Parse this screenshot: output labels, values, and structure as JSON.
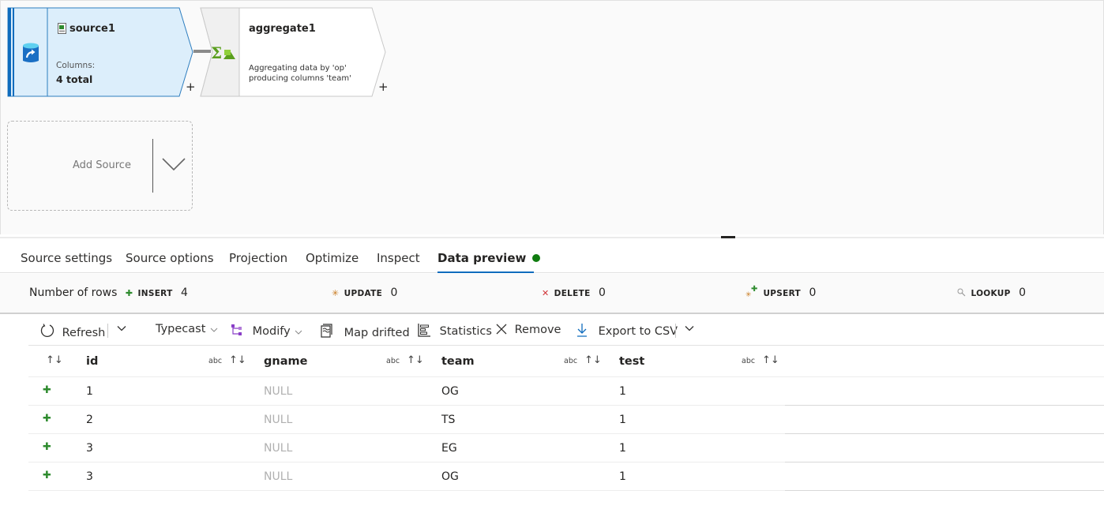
{
  "canvas": {
    "source_node": {
      "title": "source1",
      "columns_label": "Columns:",
      "columns_value": "4 total",
      "icon": "database-source-icon",
      "file_icon": "csv-file-icon",
      "add_label": "+"
    },
    "aggregate_node": {
      "title": "aggregate1",
      "description_line1": "Aggregating data by 'op'",
      "description_line2": "producing columns 'team'",
      "icon": "aggregate-sigma-icon",
      "add_label": "+"
    },
    "add_source": {
      "label": "Add Source",
      "icon": "chevron-down-icon"
    }
  },
  "tabs": [
    {
      "label": "Source settings",
      "active": false
    },
    {
      "label": "Source options",
      "active": false
    },
    {
      "label": "Projection",
      "active": false
    },
    {
      "label": "Optimize",
      "active": false
    },
    {
      "label": "Inspect",
      "active": false
    },
    {
      "label": "Data preview",
      "active": true,
      "status_color": "#107c10"
    }
  ],
  "row_counts": {
    "label": "Number of rows",
    "insert": {
      "keyword": "INSERT",
      "value": "4",
      "color": "#2e8b2e"
    },
    "update": {
      "keyword": "UPDATE",
      "value": "0",
      "color": "#c87a1e"
    },
    "delete": {
      "keyword": "DELETE",
      "value": "0",
      "color": "#d13438"
    },
    "upsert": {
      "keyword": "UPSERT",
      "value": "0",
      "color": "#2e8b2e"
    },
    "lookup": {
      "keyword": "LOOKUP",
      "value": "0",
      "color": "#888888"
    }
  },
  "toolbar": {
    "refresh": "Refresh",
    "typecast": "Typecast",
    "modify": "Modify",
    "map_drifted": "Map drifted",
    "statistics": "Statistics",
    "remove": "Remove",
    "export_csv": "Export to CSV"
  },
  "table": {
    "type_label": "abc",
    "columns": [
      "id",
      "gname",
      "team",
      "test"
    ],
    "rows": [
      {
        "op": "+",
        "id": "1",
        "gname": "NULL",
        "team": "OG",
        "test": "1"
      },
      {
        "op": "+",
        "id": "2",
        "gname": "NULL",
        "team": "TS",
        "test": "1"
      },
      {
        "op": "+",
        "id": "3",
        "gname": "NULL",
        "team": "EG",
        "test": "1"
      },
      {
        "op": "+",
        "id": "3",
        "gname": "NULL",
        "team": "OG",
        "test": "1"
      }
    ]
  }
}
